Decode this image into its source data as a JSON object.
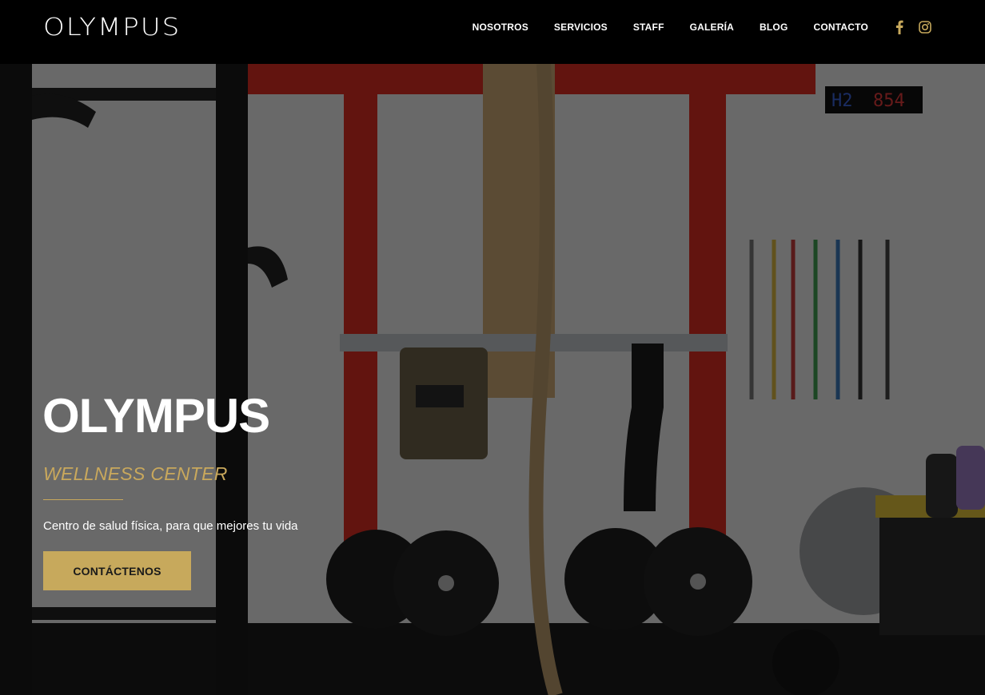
{
  "header": {
    "logo": "OLYMPUS",
    "nav": [
      "NOSOTROS",
      "SERVICIOS",
      "STAFF",
      "GALERÍA",
      "BLOG",
      "CONTACTO"
    ],
    "social_icons": [
      "facebook-icon",
      "instagram-icon"
    ]
  },
  "hero": {
    "title": "OLYMPUS",
    "subtitle": "WELLNESS CENTER",
    "description": "Centro de salud física, para que mejores tu vida",
    "cta_label": "CONTÁCTENOS",
    "timer": {
      "left": "H2",
      "right": "854"
    }
  },
  "colors": {
    "accent": "#c7a95c",
    "header_bg": "#000000",
    "wall_red": "#d92e22"
  }
}
